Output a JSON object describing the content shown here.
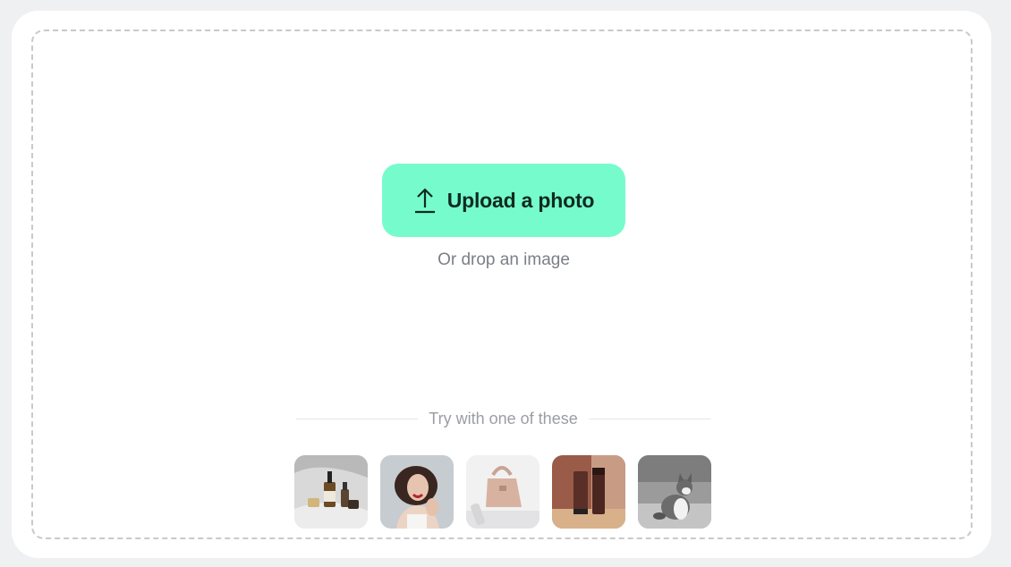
{
  "upload": {
    "button_label": "Upload a photo",
    "icon": "upload-arrow-icon",
    "drop_hint": "Or drop an image"
  },
  "samples": {
    "title": "Try with one of these",
    "items": [
      {
        "subject": "skincare bottles",
        "icon": "sample-image-skincare"
      },
      {
        "subject": "smiling woman with curly hair",
        "icon": "sample-image-portrait"
      },
      {
        "subject": "pink handbag",
        "icon": "sample-image-handbag"
      },
      {
        "subject": "brown cosmetic tubes",
        "icon": "sample-image-cosmetics"
      },
      {
        "subject": "grey and white kitten",
        "icon": "sample-image-kitten"
      }
    ]
  },
  "colors": {
    "accent": "#76fbcc",
    "button_text": "#0f2a22",
    "background": "#eff0f2",
    "border": "#c9c9cc"
  }
}
